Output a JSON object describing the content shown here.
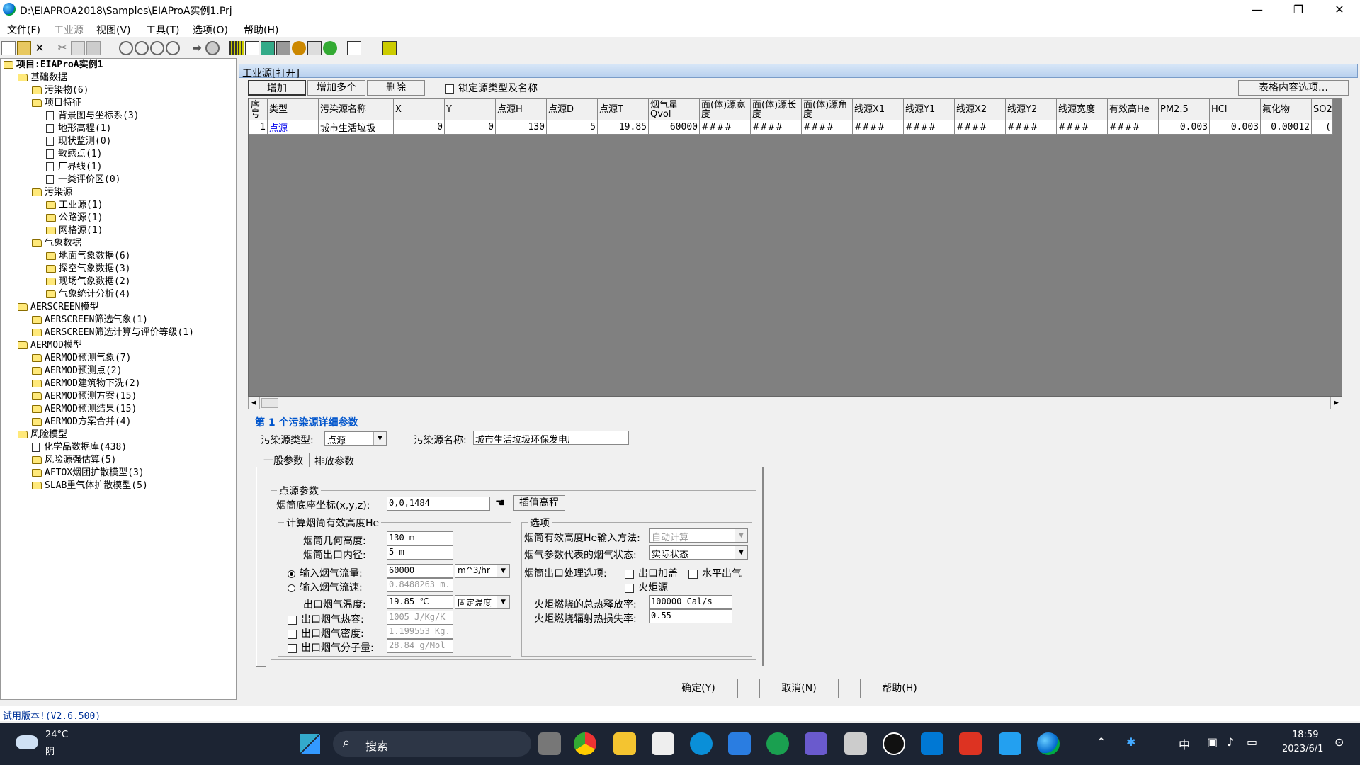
{
  "window": {
    "title": "D:\\EIAPROA2018\\Samples\\EIAProA实例1.Prj",
    "min": "—",
    "max": "❐",
    "close": "✕"
  },
  "menu": [
    "文件(F)",
    "工业源",
    "视图(V)",
    "工具(T)",
    "选项(O)",
    "帮助(H)"
  ],
  "tree": [
    {
      "label": "项目:EIAProA实例1",
      "lvl": 0,
      "icon": "folder"
    },
    {
      "label": "基础数据",
      "lvl": 1,
      "icon": "folder"
    },
    {
      "label": "污染物(6)",
      "lvl": 2,
      "icon": "folder"
    },
    {
      "label": "项目特征",
      "lvl": 2,
      "icon": "folder"
    },
    {
      "label": "背景图与坐标系(3)",
      "lvl": 3,
      "icon": "doc"
    },
    {
      "label": "地形高程(1)",
      "lvl": 3,
      "icon": "doc"
    },
    {
      "label": "现状监测(0)",
      "lvl": 3,
      "icon": "doc"
    },
    {
      "label": "敏感点(1)",
      "lvl": 3,
      "icon": "doc"
    },
    {
      "label": "厂界线(1)",
      "lvl": 3,
      "icon": "doc"
    },
    {
      "label": "一类评价区(0)",
      "lvl": 3,
      "icon": "doc"
    },
    {
      "label": "污染源",
      "lvl": 2,
      "icon": "folder"
    },
    {
      "label": "工业源(1)",
      "lvl": 3,
      "icon": "folder"
    },
    {
      "label": "公路源(1)",
      "lvl": 3,
      "icon": "folder"
    },
    {
      "label": "网格源(1)",
      "lvl": 3,
      "icon": "folder"
    },
    {
      "label": "气象数据",
      "lvl": 2,
      "icon": "folder"
    },
    {
      "label": "地面气象数据(6)",
      "lvl": 3,
      "icon": "folder"
    },
    {
      "label": "探空气象数据(3)",
      "lvl": 3,
      "icon": "folder"
    },
    {
      "label": "现场气象数据(2)",
      "lvl": 3,
      "icon": "folder"
    },
    {
      "label": "气象统计分析(4)",
      "lvl": 3,
      "icon": "folder"
    },
    {
      "label": "AERSCREEN模型",
      "lvl": 1,
      "icon": "folder"
    },
    {
      "label": "AERSCREEN筛选气象(1)",
      "lvl": 2,
      "icon": "folder"
    },
    {
      "label": "AERSCREEN筛选计算与评价等级(1)",
      "lvl": 2,
      "icon": "folder"
    },
    {
      "label": "AERMOD模型",
      "lvl": 1,
      "icon": "folder"
    },
    {
      "label": "AERMOD预测气象(7)",
      "lvl": 2,
      "icon": "folder"
    },
    {
      "label": "AERMOD预测点(2)",
      "lvl": 2,
      "icon": "folder"
    },
    {
      "label": "AERMOD建筑物下洗(2)",
      "lvl": 2,
      "icon": "folder"
    },
    {
      "label": "AERMOD预测方案(15)",
      "lvl": 2,
      "icon": "folder"
    },
    {
      "label": "AERMOD预测结果(15)",
      "lvl": 2,
      "icon": "folder"
    },
    {
      "label": "AERMOD方案合并(4)",
      "lvl": 2,
      "icon": "folder"
    },
    {
      "label": "风险模型",
      "lvl": 1,
      "icon": "folder"
    },
    {
      "label": "化学品数据库(438)",
      "lvl": 2,
      "icon": "doc"
    },
    {
      "label": "风险源强估算(5)",
      "lvl": 2,
      "icon": "folder"
    },
    {
      "label": "AFTOX烟团扩散模型(3)",
      "lvl": 2,
      "icon": "folder"
    },
    {
      "label": "SLAB重气体扩散模型(5)",
      "lvl": 2,
      "icon": "folder"
    }
  ],
  "panel": {
    "title": "工业源[打开]",
    "add": "增加",
    "add_many": "增加多个",
    "delete": "删除",
    "lock_label": "锁定源类型及名称",
    "table_options": "表格内容选项…"
  },
  "grid": {
    "headers": [
      "序号",
      "类型",
      "污染源名称",
      "X",
      "Y",
      "点源H",
      "点源D",
      "点源T",
      "烟气量Qvol",
      "面(体)源宽度",
      "面(体)源长度",
      "面(体)源角度",
      "线源X1",
      "线源Y1",
      "线源X2",
      "线源Y2",
      "线源宽度",
      "有效高He",
      "PM2.5",
      "HCl",
      "氟化物",
      "SO2"
    ],
    "rows": [
      [
        "1",
        "点源",
        "城市生活垃圾",
        "0",
        "0",
        "130",
        "5",
        "19.85",
        "60000",
        "####",
        "####",
        "####",
        "####",
        "####",
        "####",
        "####",
        "####",
        "####",
        "0.003",
        "0.003",
        "0.00012",
        "("
      ]
    ]
  },
  "detail": {
    "heading": "第 1 个污染源详细参数",
    "src_type_label": "污染源类型:",
    "src_type_value": "点源",
    "src_name_label": "污染源名称:",
    "src_name_value": "城市生活垃圾环保发电厂",
    "tab_general": "一般参数",
    "tab_emission": "排放参数",
    "point_group": "点源参数",
    "base_coord_label": "烟筒底座坐标(x,y,z):",
    "base_coord_value": "0,0,1484",
    "interp_btn": "插值高程",
    "calc_group": "计算烟筒有效高度He",
    "geo_height_label": "烟筒几何高度:",
    "geo_height_value": "130 m",
    "inner_diam_label": "烟筒出口内径:",
    "inner_diam_value": "5 m",
    "flow_label": "输入烟气流量:",
    "flow_value": "60000",
    "flow_unit": "m^3/hr",
    "velocity_label": "输入烟气流速:",
    "velocity_value": "0.8488263 m.",
    "temp_label": "出口烟气温度:",
    "temp_value": "19.85 ℃",
    "temp_mode": "固定温度",
    "heatcap_label": "出口烟气热容:",
    "heatcap_value": "1005 J/Kg/K",
    "density_label": "出口烟气密度:",
    "density_value": "1.199553 Kg.",
    "molwt_label": "出口烟气分子量:",
    "molwt_value": "28.84 g/Mol",
    "options_group": "选项",
    "he_method_label": "烟筒有效高度He输入方法:",
    "he_method_value": "自动计算",
    "gas_state_label": "烟气参数代表的烟气状态:",
    "gas_state_value": "实际状态",
    "outlet_opt_label": "烟筒出口处理选项:",
    "cap_label": "出口加盖",
    "horiz_label": "水平出气",
    "flare_label": "火炬源",
    "flare_heat_label": "火炬燃烧的总热释放率:",
    "flare_heat_value": "100000 Cal/s",
    "flare_loss_label": "火炬燃烧辐射热损失率:",
    "flare_loss_value": "0.55"
  },
  "footer": {
    "ok": "确定(Y)",
    "cancel": "取消(N)",
    "help": "帮助(H)"
  },
  "status": "试用版本!(V2.6.500)",
  "taskbar": {
    "weather_temp": "24°C",
    "weather_desc": "阴",
    "search": "搜索",
    "ime": "中",
    "time": "18:59",
    "date": "2023/6/1"
  },
  "colors": {
    "title_accent": "#0055cc",
    "link": "#0000ee",
    "taskbar": "#1c2433"
  }
}
